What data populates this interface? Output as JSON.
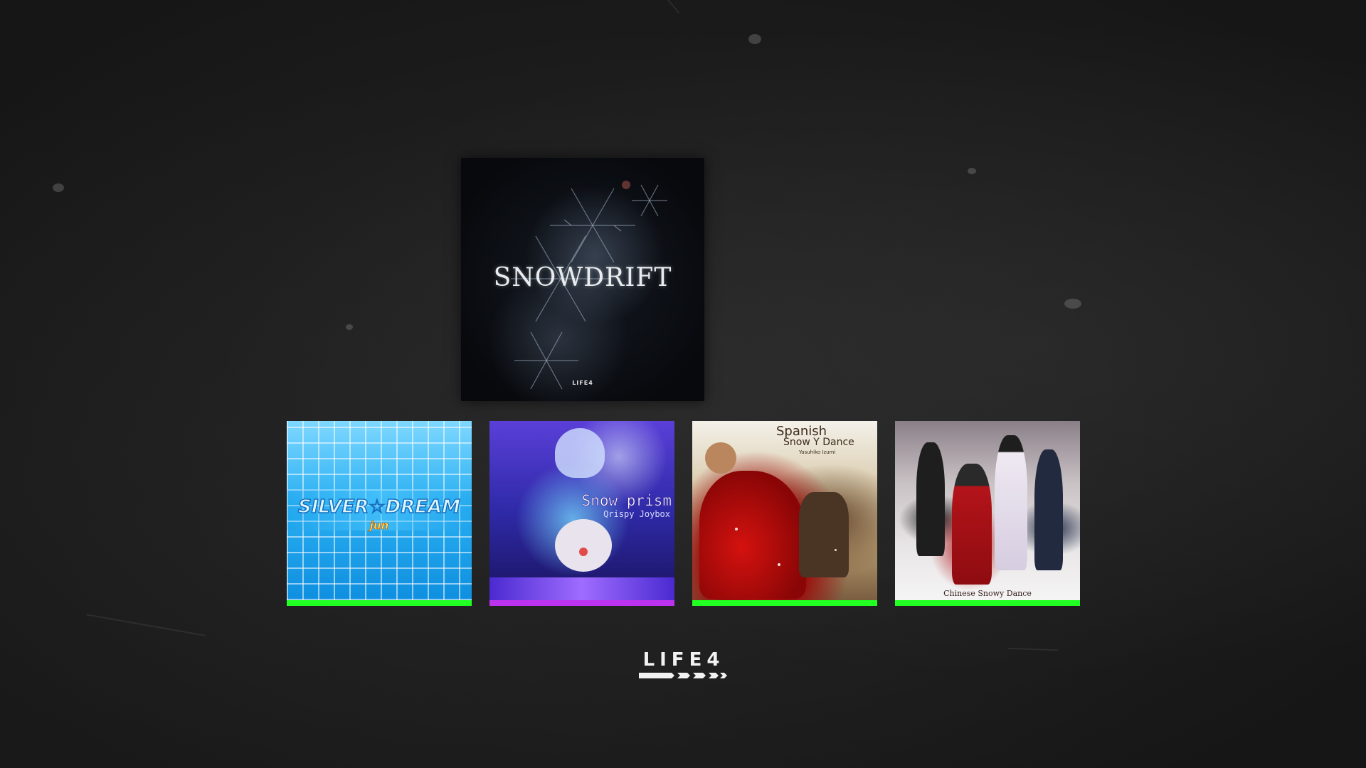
{
  "featured": {
    "title": "SNOWDRIFT",
    "brand_mark": "LIFE4"
  },
  "jackets": [
    {
      "title": "SILVER☆DREAM",
      "artist": "jun",
      "bar_color": "#22ff22"
    },
    {
      "title": "Snow prism",
      "artist": "Qrispy Joybox",
      "bar_color": "#bb33ee"
    },
    {
      "title_line1": "Spanish",
      "title_line2": "Snow Y Dance",
      "artist": "Yasuhiko Izumi",
      "bar_color": "#22ff22"
    },
    {
      "title": "Chinese Snowy Dance",
      "bar_color": "#22ff22"
    }
  ],
  "logo": {
    "text": "LIFE4"
  }
}
